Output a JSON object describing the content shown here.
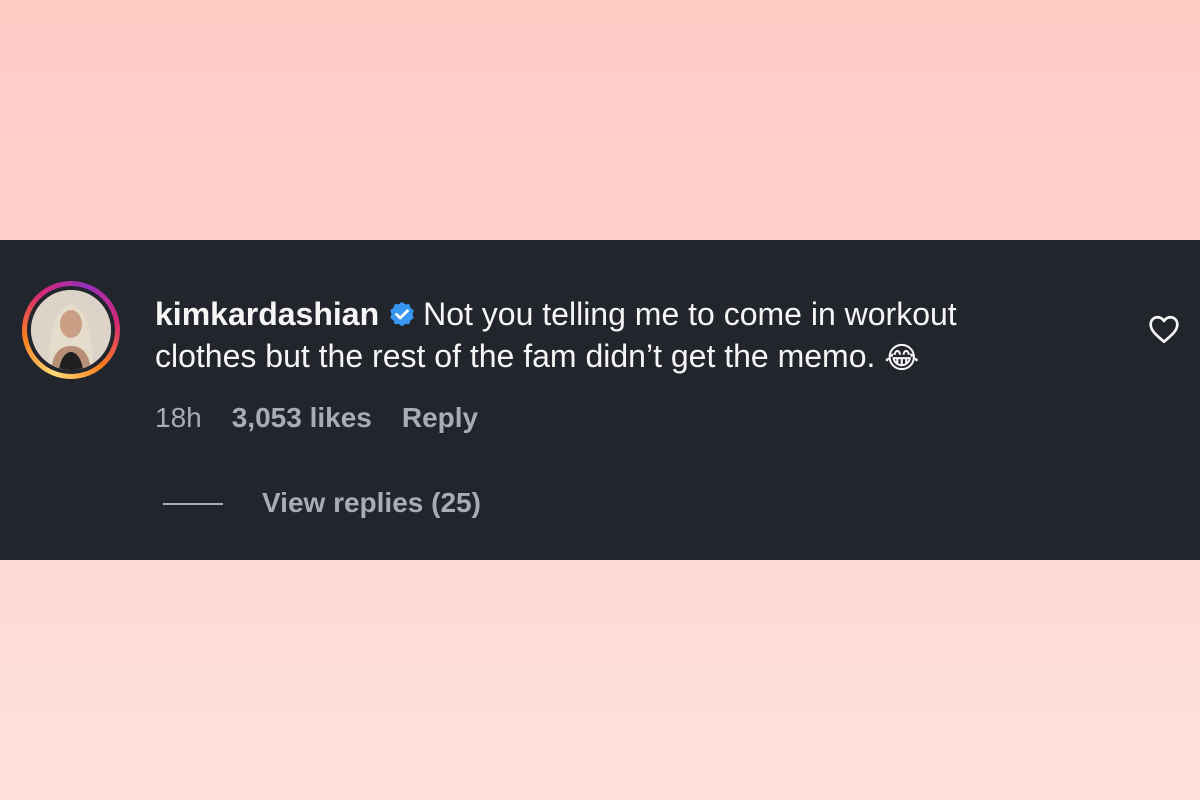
{
  "comment": {
    "username": "kimkardashian",
    "text": "Not you telling me to come in workout clothes but the rest of the fam didn’t get the memo.",
    "emoji": "😂",
    "time": "18h",
    "likes": "3,053 likes",
    "reply_label": "Reply",
    "view_replies_label": "View replies (25)"
  },
  "icons": {
    "verified": "verified-badge-icon",
    "like": "heart-icon"
  },
  "colors": {
    "background_top": "#ffccc6",
    "banner": "#22252c",
    "text": "#f5f5f5",
    "muted": "#a8acb3",
    "verified_blue": "#3897f0"
  }
}
